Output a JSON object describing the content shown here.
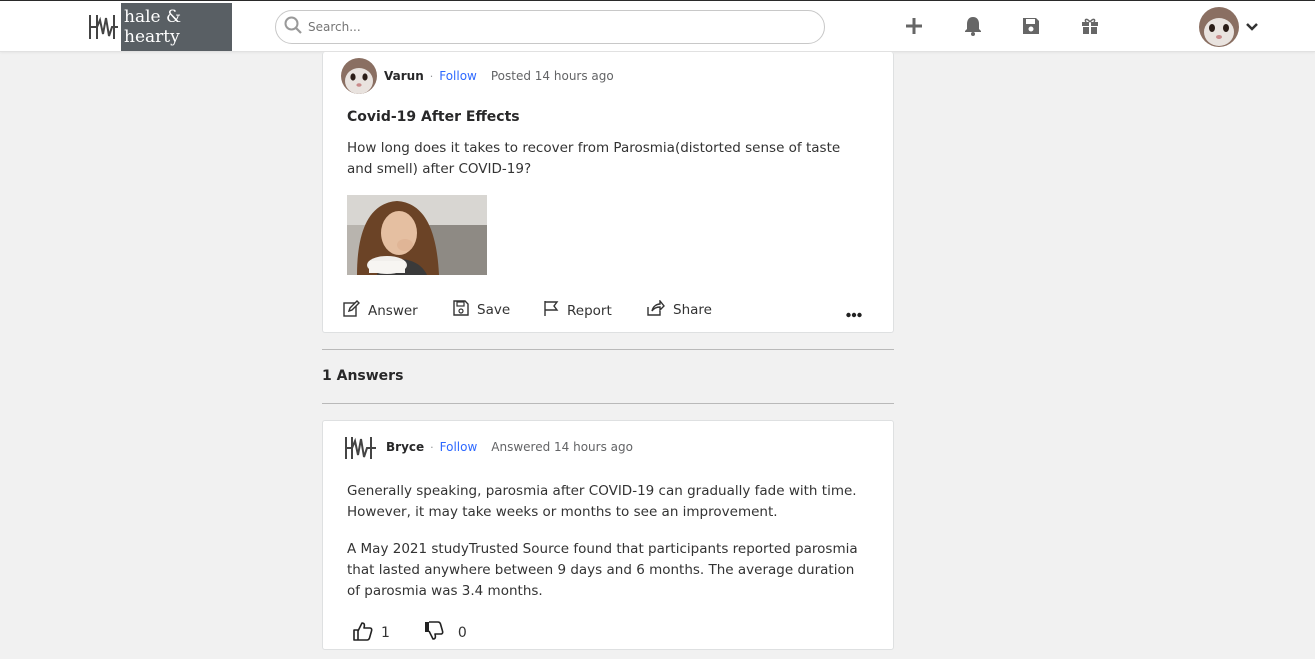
{
  "brand": {
    "name": "hale & hearty",
    "colors": {
      "logo_bg": "#595f64",
      "link": "#2e69ff"
    }
  },
  "search": {
    "placeholder": "Search..."
  },
  "nav": {
    "icons": [
      "plus-icon",
      "bell-icon",
      "save-icon",
      "gift-icon"
    ]
  },
  "question": {
    "author": "Varun",
    "follow_label": "Follow",
    "posted": "Posted 14 hours ago",
    "title": "Covid-19 After Effects",
    "body": "How long does it takes to recover from Parosmia(distorted sense of taste and smell) after COVID-19?",
    "actions": {
      "answer": "Answer",
      "save": "Save",
      "report": "Report",
      "share": "Share"
    }
  },
  "answers_header": "1 Answers",
  "answer": {
    "author": "Bryce",
    "follow_label": "Follow",
    "answered": "Answered 14 hours ago",
    "paragraphs": [
      "Generally speaking, parosmia after COVID-19 can gradually fade with time. However, it may take weeks or months to see an improvement.",
      "A May 2021 studyTrusted Source found that participants reported parosmia that lasted anywhere between 9 days and 6 months. The average duration of parosmia was 3.4 months."
    ],
    "upvotes": "1",
    "downvotes": "0"
  }
}
